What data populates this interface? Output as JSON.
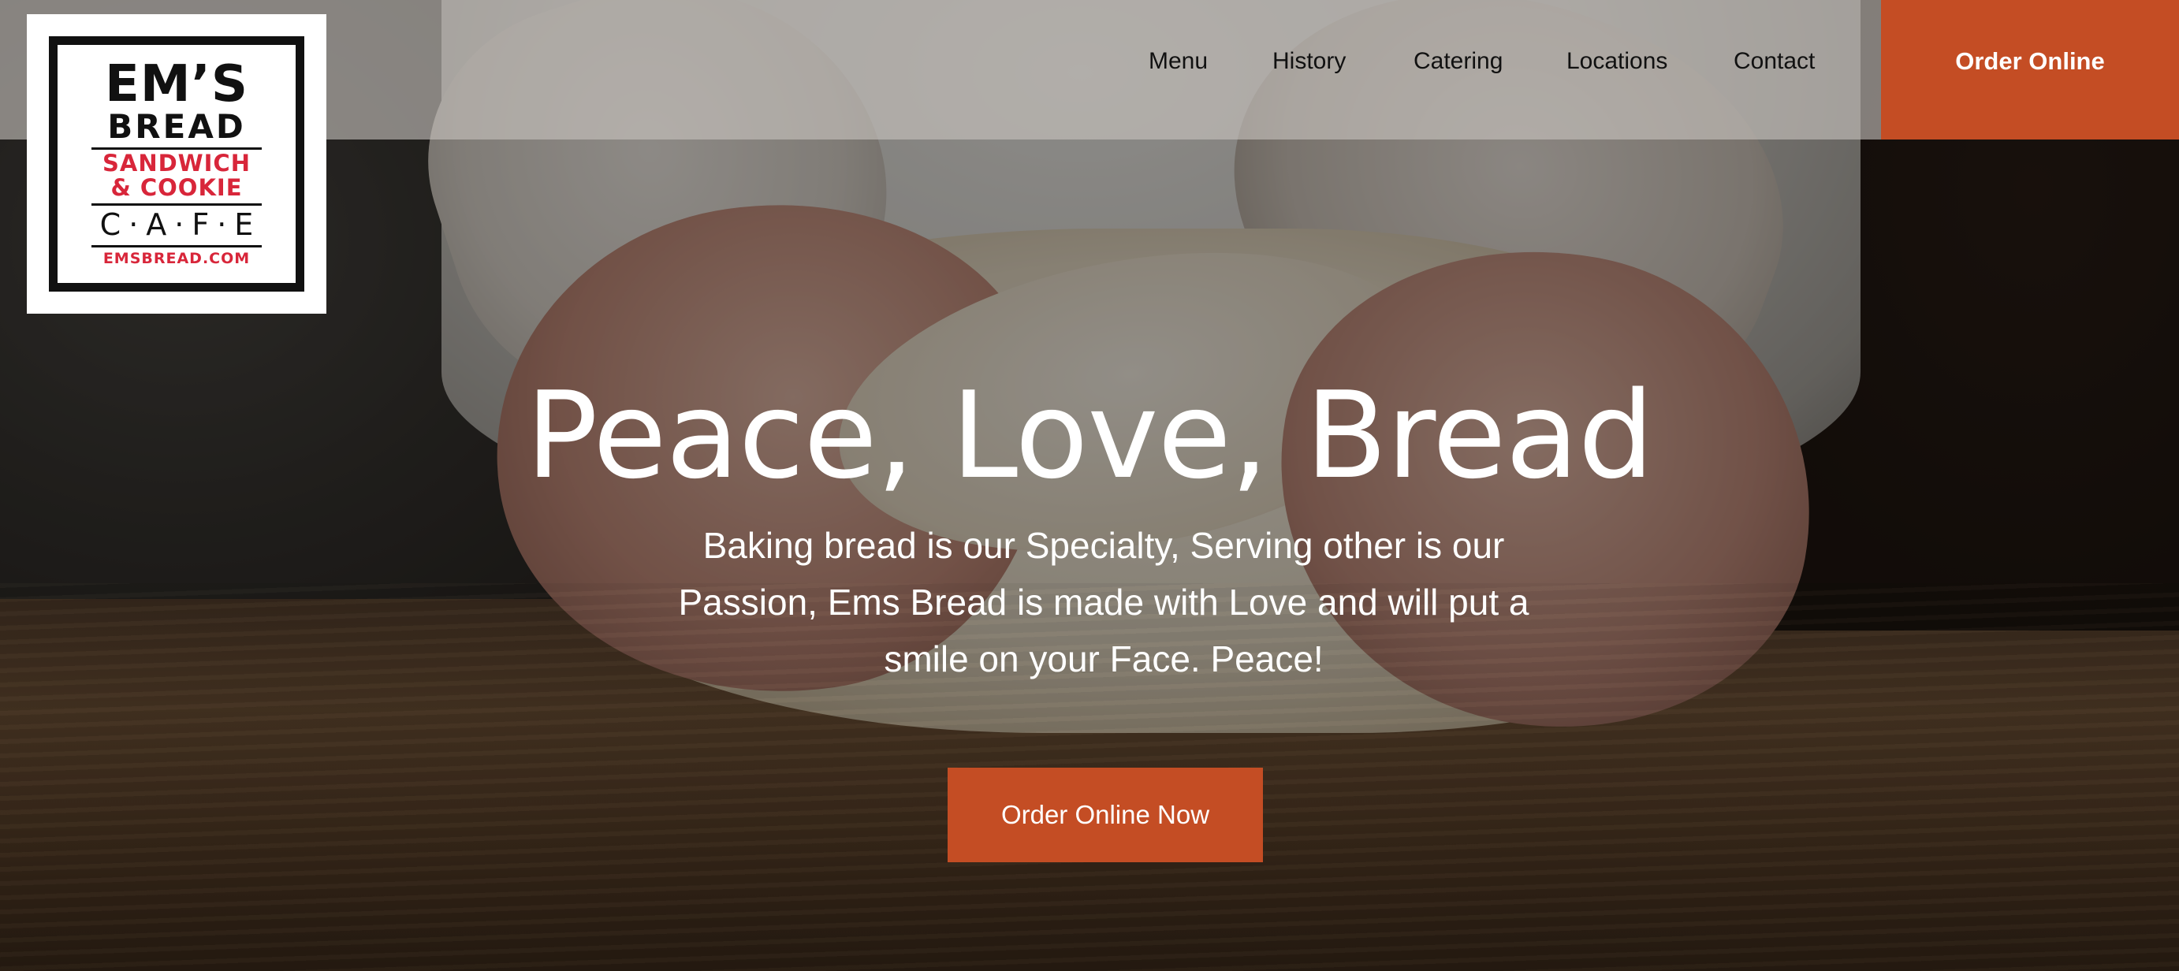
{
  "logo": {
    "line1": "EM’S",
    "line2": "BREAD",
    "line3": "SANDWICH",
    "line4": "& COOKIE",
    "line5": "C·A·F·E",
    "line6": "EMSBREAD.COM"
  },
  "nav": {
    "items": [
      {
        "label": "Menu"
      },
      {
        "label": "History"
      },
      {
        "label": "Catering"
      },
      {
        "label": "Locations"
      },
      {
        "label": "Contact"
      }
    ],
    "order_button": "Order Online"
  },
  "hero": {
    "title": "Peace, Love, Bread",
    "subtitle": "Baking bread is our Specialty, Serving other is our Passion, Ems Bread is made with Love and will put a smile on your Face. Peace!",
    "cta": "Order Online Now"
  },
  "colors": {
    "accent": "#c44d24",
    "logo_red": "#d8263a",
    "header_bg": "#c8c4be"
  }
}
